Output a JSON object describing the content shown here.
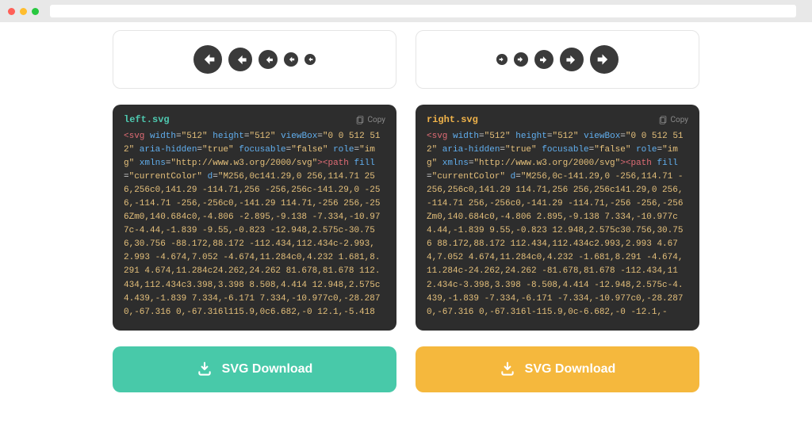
{
  "left": {
    "filename": "left.svg",
    "copy_label": "Copy",
    "download_label": "SVG Download",
    "code_tokens": [
      {
        "cls": "tok-tag",
        "t": "<svg"
      },
      {
        "cls": "tok-attr",
        "t": " width"
      },
      {
        "cls": "tok-text",
        "t": "="
      },
      {
        "cls": "tok-val",
        "t": "\"512\""
      },
      {
        "cls": "tok-attr",
        "t": " height"
      },
      {
        "cls": "tok-text",
        "t": "="
      },
      {
        "cls": "tok-val",
        "t": "\"512\""
      },
      {
        "cls": "tok-attr",
        "t": " viewBox"
      },
      {
        "cls": "tok-text",
        "t": "="
      },
      {
        "cls": "tok-val",
        "t": "\"0 0 512 512\""
      },
      {
        "cls": "tok-attr",
        "t": " aria-hidden"
      },
      {
        "cls": "tok-text",
        "t": "="
      },
      {
        "cls": "tok-val",
        "t": "\"true\""
      },
      {
        "cls": "tok-attr",
        "t": " focusable"
      },
      {
        "cls": "tok-text",
        "t": "="
      },
      {
        "cls": "tok-val",
        "t": "\"false\""
      },
      {
        "cls": "tok-attr",
        "t": " role"
      },
      {
        "cls": "tok-text",
        "t": "="
      },
      {
        "cls": "tok-val",
        "t": "\"img\""
      },
      {
        "cls": "tok-attr",
        "t": " xmlns"
      },
      {
        "cls": "tok-text",
        "t": "="
      },
      {
        "cls": "tok-val",
        "t": "\"http://www.w3.org/2000/svg\""
      },
      {
        "cls": "tok-tag",
        "t": "><path"
      },
      {
        "cls": "tok-attr",
        "t": " fill"
      },
      {
        "cls": "tok-text",
        "t": "="
      },
      {
        "cls": "tok-val",
        "t": "\"currentColor\""
      },
      {
        "cls": "tok-attr",
        "t": " d"
      },
      {
        "cls": "tok-text",
        "t": "="
      },
      {
        "cls": "tok-val",
        "t": "\"M256,0c141.29,0 256,114.71 256,256c0,141.29 -114.71,256 -256,256c-141.29,0 -256,-114.71 -256,-256c0,-141.29 114.71,-256 256,-256Zm0,140.684c0,-4.806 -2.895,-9.138 -7.334,-10.977c-4.44,-1.839 -9.55,-0.823 -12.948,2.575c-30.756,30.756 -88.172,88.172 -112.434,112.434c-2.993,2.993 -4.674,7.052 -4.674,11.284c0,4.232 1.681,8.291 4.674,11.284c24.262,24.262 81.678,81.678 112.434,112.434c3.398,3.398 8.508,4.414 12.948,2.575c4.439,-1.839 7.334,-6.171 7.334,-10.977c0,-28.287 0,-67.316 0,-67.316l115.9,0c6.682,-0 12.1,-5.418"
      }
    ],
    "preview_sizes": [
      "sz36",
      "sz30",
      "sz24",
      "sz18",
      "sz14"
    ],
    "arrow_direction": "left"
  },
  "right": {
    "filename": "right.svg",
    "copy_label": "Copy",
    "download_label": "SVG Download",
    "code_tokens": [
      {
        "cls": "tok-tag",
        "t": "<svg"
      },
      {
        "cls": "tok-attr",
        "t": " width"
      },
      {
        "cls": "tok-text",
        "t": "="
      },
      {
        "cls": "tok-val",
        "t": "\"512\""
      },
      {
        "cls": "tok-attr",
        "t": " height"
      },
      {
        "cls": "tok-text",
        "t": "="
      },
      {
        "cls": "tok-val",
        "t": "\"512\""
      },
      {
        "cls": "tok-attr",
        "t": " viewBox"
      },
      {
        "cls": "tok-text",
        "t": "="
      },
      {
        "cls": "tok-val",
        "t": "\"0 0 512 512\""
      },
      {
        "cls": "tok-attr",
        "t": " aria-hidden"
      },
      {
        "cls": "tok-text",
        "t": "="
      },
      {
        "cls": "tok-val",
        "t": "\"true\""
      },
      {
        "cls": "tok-attr",
        "t": " focusable"
      },
      {
        "cls": "tok-text",
        "t": "="
      },
      {
        "cls": "tok-val",
        "t": "\"false\""
      },
      {
        "cls": "tok-attr",
        "t": " role"
      },
      {
        "cls": "tok-text",
        "t": "="
      },
      {
        "cls": "tok-val",
        "t": "\"img\""
      },
      {
        "cls": "tok-attr",
        "t": " xmlns"
      },
      {
        "cls": "tok-text",
        "t": "="
      },
      {
        "cls": "tok-val",
        "t": "\"http://www.w3.org/2000/svg\""
      },
      {
        "cls": "tok-tag",
        "t": "><path"
      },
      {
        "cls": "tok-attr",
        "t": " fill"
      },
      {
        "cls": "tok-text",
        "t": "="
      },
      {
        "cls": "tok-val",
        "t": "\"currentColor\""
      },
      {
        "cls": "tok-attr",
        "t": " d"
      },
      {
        "cls": "tok-text",
        "t": "="
      },
      {
        "cls": "tok-val",
        "t": "\"M256,0c-141.29,0 -256,114.71 -256,256c0,141.29 114.71,256 256,256c141.29,0 256,-114.71 256,-256c0,-141.29 -114.71,-256 -256,-256Zm0,140.684c0,-4.806 2.895,-9.138 7.334,-10.977c4.44,-1.839 9.55,-0.823 12.948,2.575c30.756,30.756 88.172,88.172 112.434,112.434c2.993,2.993 4.674,7.052 4.674,11.284c0,4.232 -1.681,8.291 -4.674,11.284c-24.262,24.262 -81.678,81.678 -112.434,112.434c-3.398,3.398 -8.508,4.414 -12.948,2.575c-4.439,-1.839 -7.334,-6.171 -7.334,-10.977c0,-28.287 0,-67.316 0,-67.316l-115.9,0c-6.682,-0 -12.1,-"
      }
    ],
    "preview_sizes": [
      "sz14",
      "sz18",
      "sz24",
      "sz30",
      "sz36"
    ],
    "arrow_direction": "right"
  }
}
